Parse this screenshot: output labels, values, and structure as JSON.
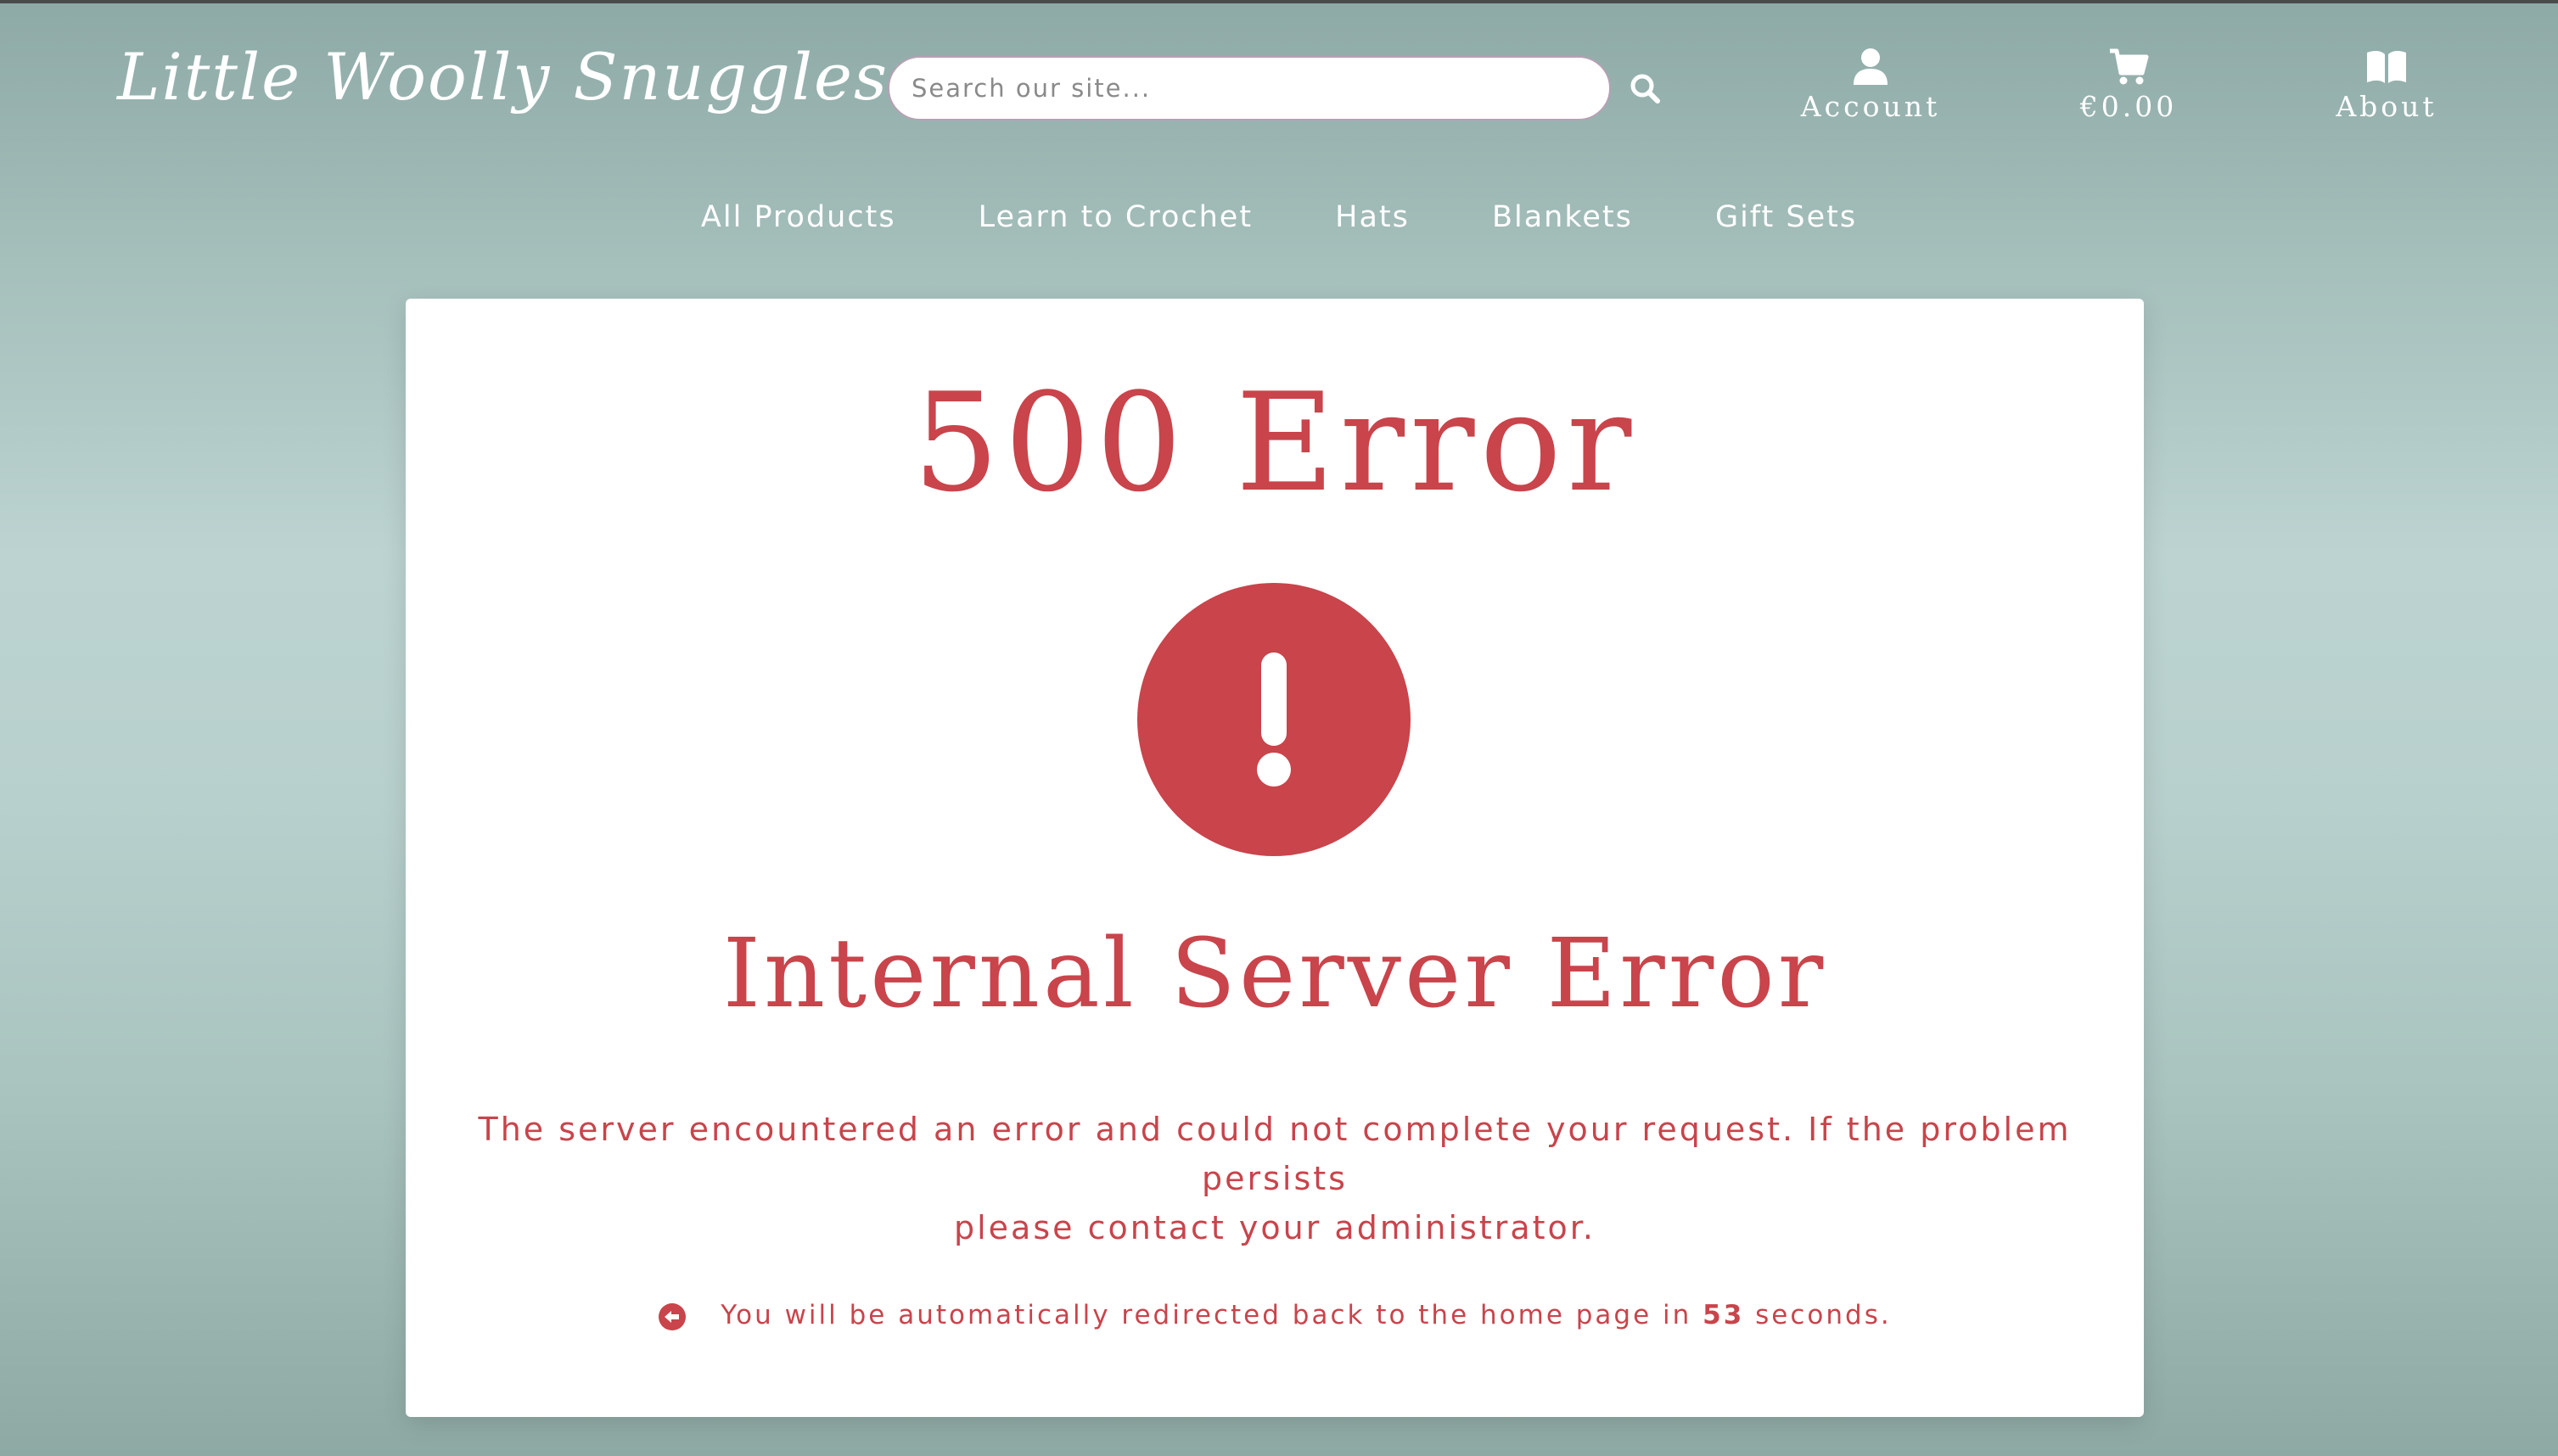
{
  "header": {
    "logo": "Little Woolly Snuggles",
    "search": {
      "placeholder": "Search our site..."
    },
    "account_label": "Account",
    "cart_label": "€0.00",
    "about_label": "About"
  },
  "nav": {
    "links": [
      "All Products",
      "Learn to Crochet",
      "Hats",
      "Blankets",
      "Gift Sets"
    ]
  },
  "error": {
    "code": "500 Error",
    "title": "Internal Server Error",
    "message_line1": "The server encountered an error and could not complete your request. If the problem persists",
    "message_line2": "please contact your administrator.",
    "redirect_prefix": "You will be automatically redirected back to the home page in",
    "redirect_seconds": "53",
    "redirect_suffix": "seconds."
  },
  "icons": {
    "search": "search-icon",
    "account": "user-icon",
    "cart": "cart-icon",
    "about": "book-icon",
    "error": "exclamation-circle-icon",
    "back": "arrow-left-circle-icon"
  },
  "colors": {
    "accent": "#c9444b",
    "header_bg": "#8eaaa6",
    "white": "#ffffff"
  }
}
